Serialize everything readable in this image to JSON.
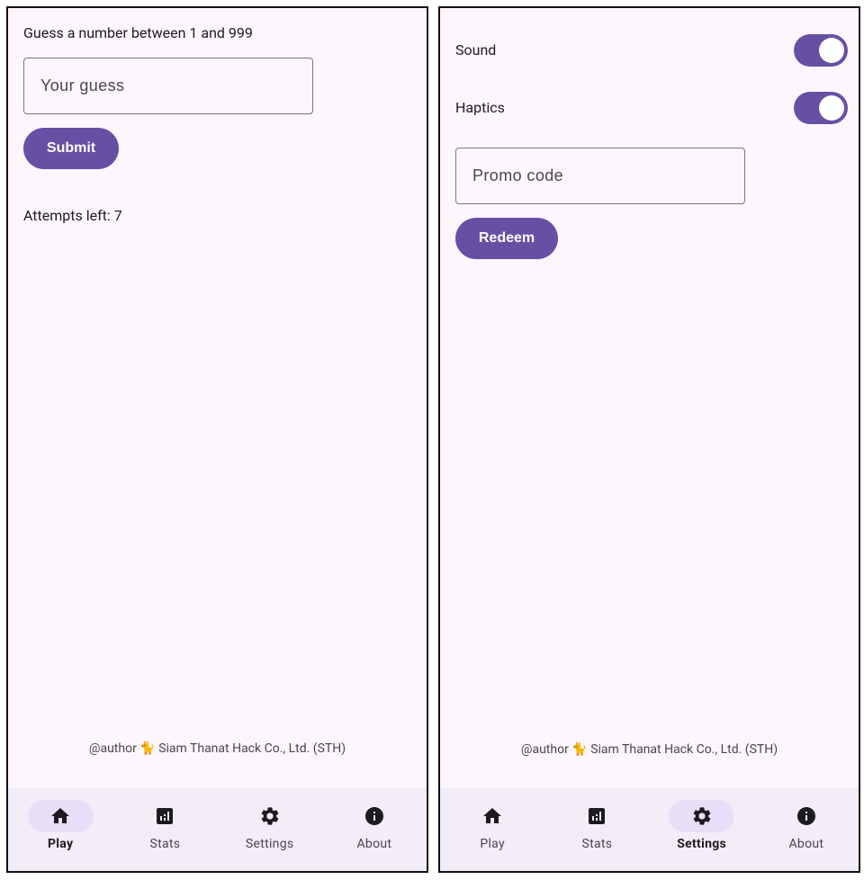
{
  "play_screen": {
    "prompt": "Guess a number between 1 and 999",
    "guess_placeholder": "Your guess",
    "submit_label": "Submit",
    "attempts_text": "Attempts left: 7",
    "footer": "@author 🐈 Siam Thanat Hack Co., Ltd. (STH)",
    "active_tab": "Play"
  },
  "settings_screen": {
    "sound_label": "Sound",
    "sound_enabled": true,
    "haptics_label": "Haptics",
    "haptics_enabled": true,
    "promo_placeholder": "Promo code",
    "redeem_label": "Redeem",
    "footer": "@author 🐈 Siam Thanat Hack Co., Ltd. (STH)",
    "active_tab": "Settings"
  },
  "nav": {
    "items": [
      {
        "label": "Play",
        "icon": "home-icon"
      },
      {
        "label": "Stats",
        "icon": "stats-icon"
      },
      {
        "label": "Settings",
        "icon": "gear-icon"
      },
      {
        "label": "About",
        "icon": "info-icon"
      }
    ]
  },
  "colors": {
    "primary": "#6750a4",
    "background": "#fdf7fd",
    "nav_background": "#f3edf7",
    "active_indicator": "#e8def8"
  }
}
